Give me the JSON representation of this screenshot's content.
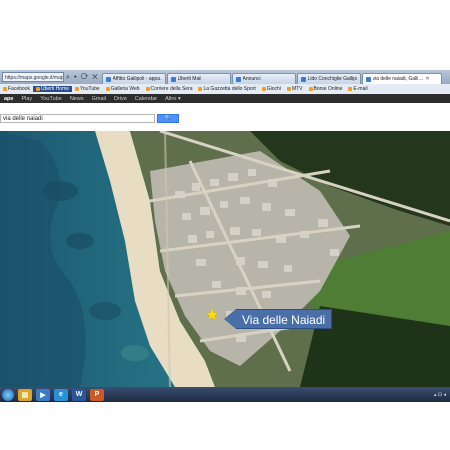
{
  "browser": {
    "address_snippet": "https://maps.google.it/maps",
    "nav_glyphs": "⌕ ▾ ⟳ ✕",
    "tabs": [
      {
        "label": "Affitto Gallipoli - appa…",
        "active": false
      },
      {
        "label": "Uberti Mail",
        "active": false
      },
      {
        "label": "Annunci",
        "active": false
      },
      {
        "label": "Lido Conchiglie Gallipo…",
        "active": false
      },
      {
        "label": "via delle naiadi, Galli…",
        "active": true
      }
    ],
    "tab_close_glyph": "✕"
  },
  "favorites": [
    {
      "label": "Facebook",
      "highlight": false
    },
    {
      "label": "Uberti Home",
      "highlight": true
    },
    {
      "label": "YouTube",
      "highlight": false
    },
    {
      "label": "Galleria Web",
      "highlight": false
    },
    {
      "label": "Corriere della Sera",
      "highlight": false
    },
    {
      "label": "La Gazzetta dello Sport",
      "highlight": false
    },
    {
      "label": "Giochi",
      "highlight": false
    },
    {
      "label": "MTV",
      "highlight": false
    },
    {
      "label": "Borse Online",
      "highlight": false
    },
    {
      "label": "E-mail",
      "highlight": false
    }
  ],
  "google_bar": [
    "ape",
    "Play",
    "YouTube",
    "News",
    "Gmail",
    "Drive",
    "Calendar",
    "Altro ▾"
  ],
  "search": {
    "value": "via delle naiadi",
    "button_glyph": "🔍"
  },
  "map": {
    "label": "Via delle Naiadi",
    "marker_glyph": "★"
  },
  "taskbar": {
    "apps": [
      {
        "name": "explorer",
        "glyph": "▤",
        "color": "#d9a52b"
      },
      {
        "name": "media",
        "glyph": "▶",
        "color": "#3a7ac8"
      },
      {
        "name": "ie",
        "glyph": "e",
        "color": "#2a8fd6"
      },
      {
        "name": "word",
        "glyph": "W",
        "color": "#2b579a"
      },
      {
        "name": "paint",
        "glyph": "P",
        "color": "#c85a2a"
      }
    ],
    "tray": "▴ ⊡ ◂"
  },
  "colors": {
    "sea_deep": "#1f5f7a",
    "sea_shallow": "#3fa6a6",
    "beach": "#e9dcc0",
    "town": "#b9b6ad",
    "vegetation": "#2f4a24",
    "field": "#4d7a34",
    "callout": "#4a6fa8"
  }
}
